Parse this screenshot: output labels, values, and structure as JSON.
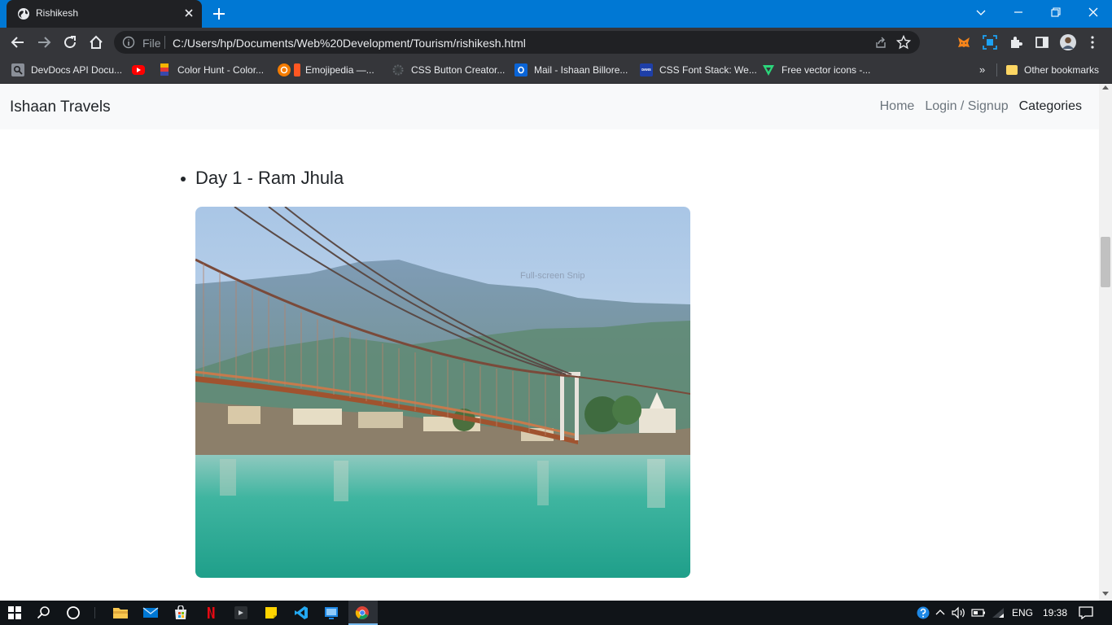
{
  "browser": {
    "tab_title": "Rishikesh",
    "omnibox": {
      "scheme_label": "File",
      "url": "C:/Users/hp/Documents/Web%20Development/Tourism/rishikesh.html"
    },
    "bookmarks": [
      {
        "label": "DevDocs API Docu...",
        "icon": "devdocs-icon",
        "color": "#8a8f98"
      },
      {
        "label": "",
        "icon": "youtube-icon",
        "color": "#ff0000"
      },
      {
        "label": "Color Hunt - Color...",
        "icon": "colorhunt-icon",
        "color": "#f4b400"
      },
      {
        "label": "Emojipedia —...",
        "icon": "emojipedia-icon",
        "color": "#f57c00"
      },
      {
        "label": "CSS Button Creator...",
        "icon": "gear-icon",
        "color": "#5f6368"
      },
      {
        "label": "Mail - Ishaan Billore...",
        "icon": "outlook-icon",
        "color": "#0a64d6"
      },
      {
        "label": "CSS Font Stack: We...",
        "icon": "cssfontstack-icon",
        "color": "#1e3fa8"
      },
      {
        "label": "Free vector icons -...",
        "icon": "flaticon-icon",
        "color": "#2bd67b"
      }
    ],
    "bookmarks_more": "»",
    "other_bookmarks": "Other bookmarks"
  },
  "site": {
    "brand": "Ishaan Travels",
    "nav": [
      "Home",
      "Login / Signup",
      "Categories"
    ],
    "day_item": "Day 1 - Ram Jhula",
    "image_overlay": "Full-screen Snip"
  },
  "taskbar": {
    "language": "ENG",
    "time": "19:38"
  },
  "colors": {
    "titlebar": "#0078d4",
    "toolbar": "#35363a",
    "navbar": "#f8f9fa",
    "taskbar": "#101418"
  }
}
